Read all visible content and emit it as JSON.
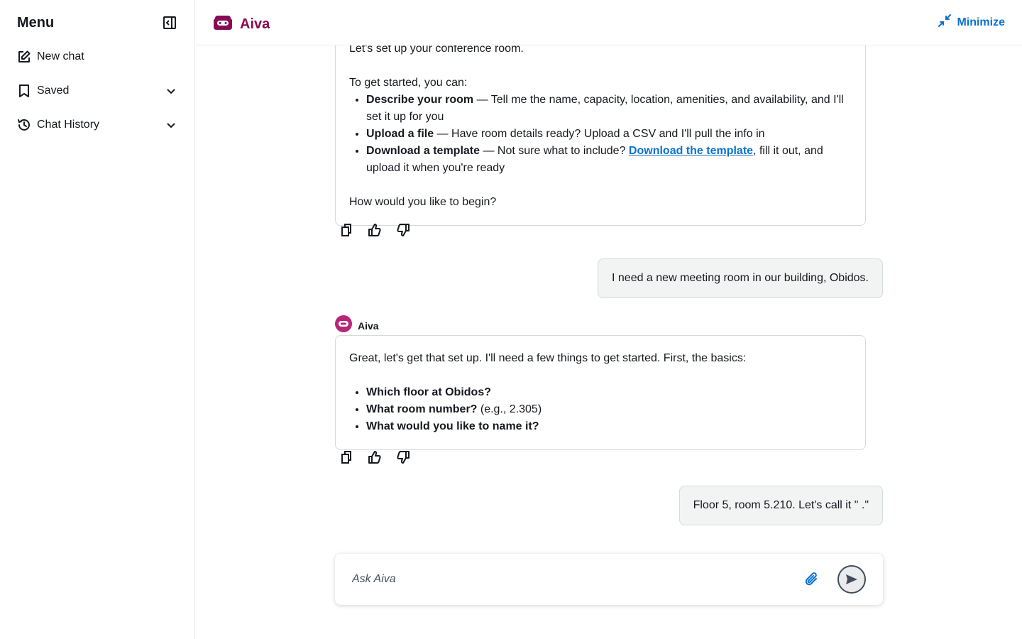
{
  "sidebar": {
    "title": "Menu",
    "items": [
      {
        "label": "New chat",
        "icon": "edit-icon"
      },
      {
        "label": "Saved",
        "icon": "bookmark-icon"
      },
      {
        "label": "Chat History",
        "icon": "history-icon"
      }
    ]
  },
  "header": {
    "brand": "Aiva",
    "minimize_label": "Minimize"
  },
  "messages": {
    "bot1": {
      "intro_partial": "Let's set up your conference room.",
      "get_started": "To get started, you can:",
      "options": [
        {
          "title": "Describe your room",
          "text": " — Tell me the name, capacity, location, amenities, and availability, and I'll set it up for you"
        },
        {
          "title": "Upload a file",
          "text": " — Have room details ready? Upload a CSV and I'll pull the info in"
        },
        {
          "title": "Download a template",
          "text_before": " — Not sure what to include? ",
          "link": "Download the template",
          "text_after": ", fill it out, and upload it when you're ready"
        }
      ],
      "closing": "How would you like to begin?"
    },
    "user1": "I need a new meeting room in our building, Obidos.",
    "bot2": {
      "sender": "Aiva",
      "intro": "Great, let's get that set up. I'll need a few things to get started. First, the basics:",
      "questions": [
        {
          "q": "Which floor at Obidos?",
          "note": ""
        },
        {
          "q": "What room number?",
          "note": " (e.g., 2.305)"
        },
        {
          "q": "What would you like to name it?",
          "note": ""
        }
      ]
    },
    "user2": "Floor 5, room 5.210. Let's call it \" .\""
  },
  "composer": {
    "placeholder": "Ask Aiva"
  },
  "colors": {
    "brand": "#870c55",
    "link": "#0972d3"
  }
}
